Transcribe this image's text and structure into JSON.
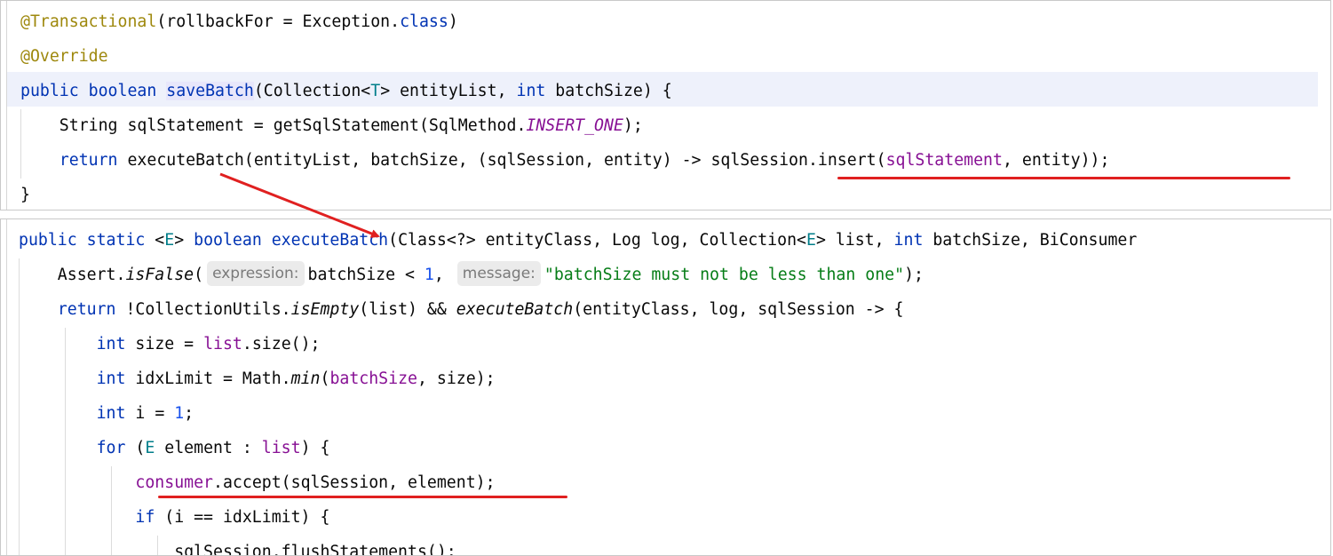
{
  "top_panel": {
    "lines": [
      {
        "tokens": [
          {
            "t": "@Transactional",
            "c": "ann"
          },
          {
            "t": "(rollbackFor = Exception.",
            "c": ""
          },
          {
            "t": "class",
            "c": "kw"
          },
          {
            "t": ")",
            "c": ""
          }
        ]
      },
      {
        "tokens": [
          {
            "t": "@Override",
            "c": "ann"
          }
        ]
      },
      {
        "tokens": [
          {
            "t": "public",
            "c": "kw"
          },
          {
            "t": " ",
            "c": ""
          },
          {
            "t": "boolean",
            "c": "kw"
          },
          {
            "t": " ",
            "c": ""
          },
          {
            "t": "saveBatch",
            "c": "kw ident-hl"
          },
          {
            "t": "(Collection<",
            "c": ""
          },
          {
            "t": "T",
            "c": "type-param"
          },
          {
            "t": "> entityList, ",
            "c": ""
          },
          {
            "t": "int",
            "c": "kw"
          },
          {
            "t": " batchSize) {",
            "c": ""
          }
        ]
      },
      {
        "tokens": [
          {
            "t": "    String sqlStatement = getSqlStatement(SqlMethod.",
            "c": ""
          },
          {
            "t": "INSERT_ONE",
            "c": "static-it"
          },
          {
            "t": ");",
            "c": ""
          }
        ]
      },
      {
        "tokens": [
          {
            "t": "    ",
            "c": ""
          },
          {
            "t": "return",
            "c": "kw"
          },
          {
            "t": " executeBatch(entityList, batchSize, (sqlSession, entity) -> sqlSession.insert(",
            "c": ""
          },
          {
            "t": "sqlStatement",
            "c": "field"
          },
          {
            "t": ", entity));",
            "c": ""
          }
        ]
      },
      {
        "tokens": [
          {
            "t": "}",
            "c": ""
          }
        ]
      }
    ]
  },
  "bottom_panel": {
    "lines": [
      {
        "tokens": [
          {
            "t": "public",
            "c": "kw"
          },
          {
            "t": " ",
            "c": ""
          },
          {
            "t": "static",
            "c": "kw"
          },
          {
            "t": " <",
            "c": ""
          },
          {
            "t": "E",
            "c": "type-param"
          },
          {
            "t": "> ",
            "c": ""
          },
          {
            "t": "boolean",
            "c": "kw"
          },
          {
            "t": " ",
            "c": ""
          },
          {
            "t": "executeBatch",
            "c": "kw"
          },
          {
            "t": "(Class<?> entityClass, Log log, Collection<",
            "c": ""
          },
          {
            "t": "E",
            "c": "type-param"
          },
          {
            "t": "> list, ",
            "c": ""
          },
          {
            "t": "int",
            "c": "kw"
          },
          {
            "t": " batchSize, BiConsumer",
            "c": ""
          }
        ]
      },
      {
        "tokens": [
          {
            "t": "    Assert.",
            "c": ""
          },
          {
            "t": "isFalse",
            "c": "it"
          },
          {
            "t": "(",
            "c": ""
          },
          {
            "t": "expression:",
            "c": "hint"
          },
          {
            "t": "batchSize < ",
            "c": ""
          },
          {
            "t": "1",
            "c": "num"
          },
          {
            "t": ", ",
            "c": ""
          },
          {
            "t": "message:",
            "c": "hint"
          },
          {
            "t": "\"batchSize must not be less than one\"",
            "c": "str"
          },
          {
            "t": ");",
            "c": ""
          }
        ]
      },
      {
        "tokens": [
          {
            "t": "    ",
            "c": ""
          },
          {
            "t": "return",
            "c": "kw"
          },
          {
            "t": " !CollectionUtils.",
            "c": ""
          },
          {
            "t": "isEmpty",
            "c": "it"
          },
          {
            "t": "(list) && ",
            "c": ""
          },
          {
            "t": "executeBatch",
            "c": "it"
          },
          {
            "t": "(entityClass, log, sqlSession -> {",
            "c": ""
          }
        ]
      },
      {
        "tokens": [
          {
            "t": "        ",
            "c": ""
          },
          {
            "t": "int",
            "c": "kw"
          },
          {
            "t": " size = ",
            "c": ""
          },
          {
            "t": "list",
            "c": "field"
          },
          {
            "t": ".size();",
            "c": ""
          }
        ]
      },
      {
        "tokens": [
          {
            "t": "        ",
            "c": ""
          },
          {
            "t": "int",
            "c": "kw"
          },
          {
            "t": " idxLimit = Math.",
            "c": ""
          },
          {
            "t": "min",
            "c": "it"
          },
          {
            "t": "(",
            "c": ""
          },
          {
            "t": "batchSize",
            "c": "field"
          },
          {
            "t": ", size);",
            "c": ""
          }
        ]
      },
      {
        "tokens": [
          {
            "t": "        ",
            "c": ""
          },
          {
            "t": "int",
            "c": "kw"
          },
          {
            "t": " i = ",
            "c": ""
          },
          {
            "t": "1",
            "c": "num"
          },
          {
            "t": ";",
            "c": ""
          }
        ]
      },
      {
        "tokens": [
          {
            "t": "        ",
            "c": ""
          },
          {
            "t": "for",
            "c": "kw"
          },
          {
            "t": " (",
            "c": ""
          },
          {
            "t": "E",
            "c": "type-param"
          },
          {
            "t": " element : ",
            "c": ""
          },
          {
            "t": "list",
            "c": "field"
          },
          {
            "t": ") {",
            "c": ""
          }
        ]
      },
      {
        "tokens": [
          {
            "t": "            ",
            "c": ""
          },
          {
            "t": "consumer",
            "c": "field"
          },
          {
            "t": ".accept(sqlSession, element);",
            "c": ""
          }
        ]
      },
      {
        "tokens": [
          {
            "t": "            ",
            "c": ""
          },
          {
            "t": "if",
            "c": "kw"
          },
          {
            "t": " (i == idxLimit) {",
            "c": ""
          }
        ]
      },
      {
        "tokens": [
          {
            "t": "                sqlSession.flushStatements();",
            "c": ""
          }
        ]
      }
    ]
  },
  "annotation_color": "#e02020"
}
